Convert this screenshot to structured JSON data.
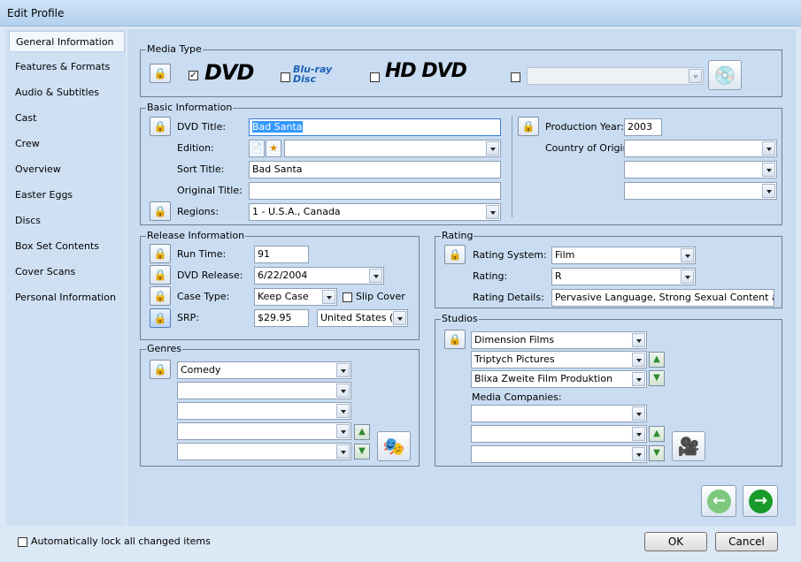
{
  "window": {
    "title": "Edit Profile"
  },
  "sidebar": {
    "items": [
      {
        "label": "General Information",
        "selected": true
      },
      {
        "label": "Features & Formats"
      },
      {
        "label": "Audio & Subtitles"
      },
      {
        "label": "Cast"
      },
      {
        "label": "Crew"
      },
      {
        "label": "Overview"
      },
      {
        "label": "Easter Eggs"
      },
      {
        "label": "Discs"
      },
      {
        "label": "Box Set Contents"
      },
      {
        "label": "Cover Scans"
      },
      {
        "label": "Personal Information"
      }
    ]
  },
  "media_type": {
    "title": "Media Type",
    "dvd": {
      "logo": "DVD",
      "checked": true,
      "check_mark": "✓"
    },
    "bluray": {
      "logo": "Blu-ray Disc",
      "checked": false
    },
    "hddvd": {
      "logo": "HD DVD",
      "checked": false
    },
    "other": {
      "checked": false,
      "value": ""
    }
  },
  "basic": {
    "title": "Basic Information",
    "dvd_title_label": "DVD Title:",
    "dvd_title": "Bad Santa",
    "edition_label": "Edition:",
    "edition": "",
    "sort_title_label": "Sort Title:",
    "sort_title": "Bad Santa",
    "original_title_label": "Original Title:",
    "original_title": "",
    "regions_label": "Regions:",
    "regions": "1 - U.S.A., Canada",
    "production_year_label": "Production Year:",
    "production_year": "2003",
    "country_label": "Country of Origin:",
    "country1": "",
    "country2": "",
    "country3": ""
  },
  "release": {
    "title": "Release Information",
    "run_time_label": "Run Time:",
    "run_time": "91",
    "dvd_release_label": "DVD Release:",
    "dvd_release": "6/22/2004",
    "case_type_label": "Case Type:",
    "case_type": "Keep Case",
    "slip_cover_label": "Slip Cover",
    "srp_label": "SRP:",
    "srp": "$29.95",
    "currency": "United States (Do"
  },
  "rating": {
    "title": "Rating",
    "system_label": "Rating System:",
    "system": "Film",
    "rating_label": "Rating:",
    "rating": "R",
    "details_label": "Rating Details:",
    "details": "Pervasive Language, Strong Sexual Content and So"
  },
  "genres": {
    "title": "Genres",
    "items": [
      "Comedy",
      "",
      "",
      "",
      ""
    ]
  },
  "studios": {
    "title": "Studios",
    "items": [
      "Dimension Films",
      "Triptych Pictures",
      "Blixa Zweite Film Produktion"
    ],
    "media_label": "Media Companies:",
    "media_items": [
      "",
      "",
      ""
    ]
  },
  "footer": {
    "auto_lock_label": "Automatically lock all changed items",
    "ok": "OK",
    "cancel": "Cancel"
  },
  "icons": {
    "lock": "🔒",
    "up": "▲",
    "down": "▼",
    "back": "←",
    "forward": "→",
    "disc_edit": "💿",
    "masks": "🎭",
    "camera": "🎥",
    "doc": "📄",
    "star": "★"
  },
  "colors": {
    "accent": "#3399ff",
    "nav_back": "#7fc97f",
    "nav_forward": "#1a9a2a"
  }
}
